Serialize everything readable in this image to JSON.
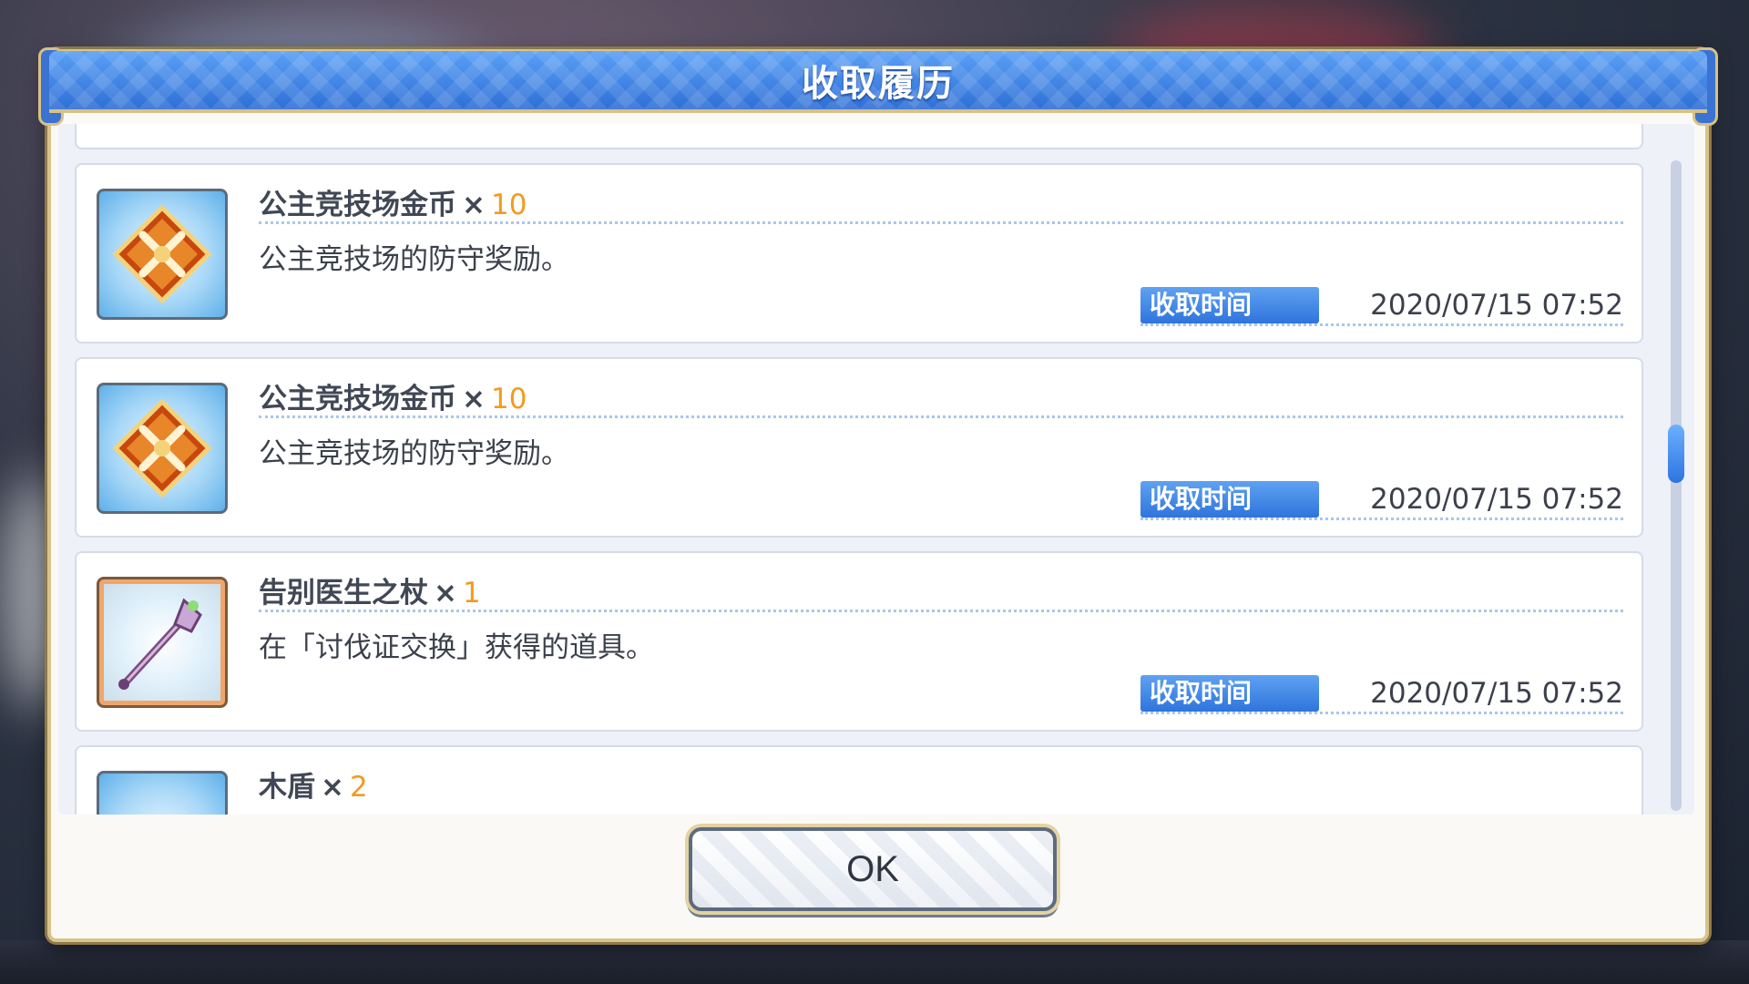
{
  "dialog": {
    "title": "收取履历"
  },
  "entries": [
    {
      "name": "公主竞技场金币",
      "mul": "×",
      "qty": "10",
      "desc": "公主竞技场的防守奖励。",
      "time_label": "收取时间",
      "time": "2020/07/15 07:52",
      "icon": "arena-coin-icon"
    },
    {
      "name": "公主竞技场金币",
      "mul": "×",
      "qty": "10",
      "desc": "公主竞技场的防守奖励。",
      "time_label": "收取时间",
      "time": "2020/07/15 07:52",
      "icon": "arena-coin-icon"
    },
    {
      "name": "告别医生之杖",
      "mul": "×",
      "qty": "1",
      "desc": "在「讨伐证交换」获得的道具。",
      "time_label": "收取时间",
      "time": "2020/07/15 07:52",
      "icon": "staff-icon"
    },
    {
      "name": "木盾",
      "mul": "×",
      "qty": "2",
      "icon": "wooden-shield-icon"
    }
  ],
  "ok_button": {
    "label": "OK"
  },
  "colors": {
    "header_blue": "#2f6fd6",
    "quantity_orange": "#f29b1e",
    "time_label_blue": "#2f74dc",
    "gold_border": "#d8c38a"
  }
}
